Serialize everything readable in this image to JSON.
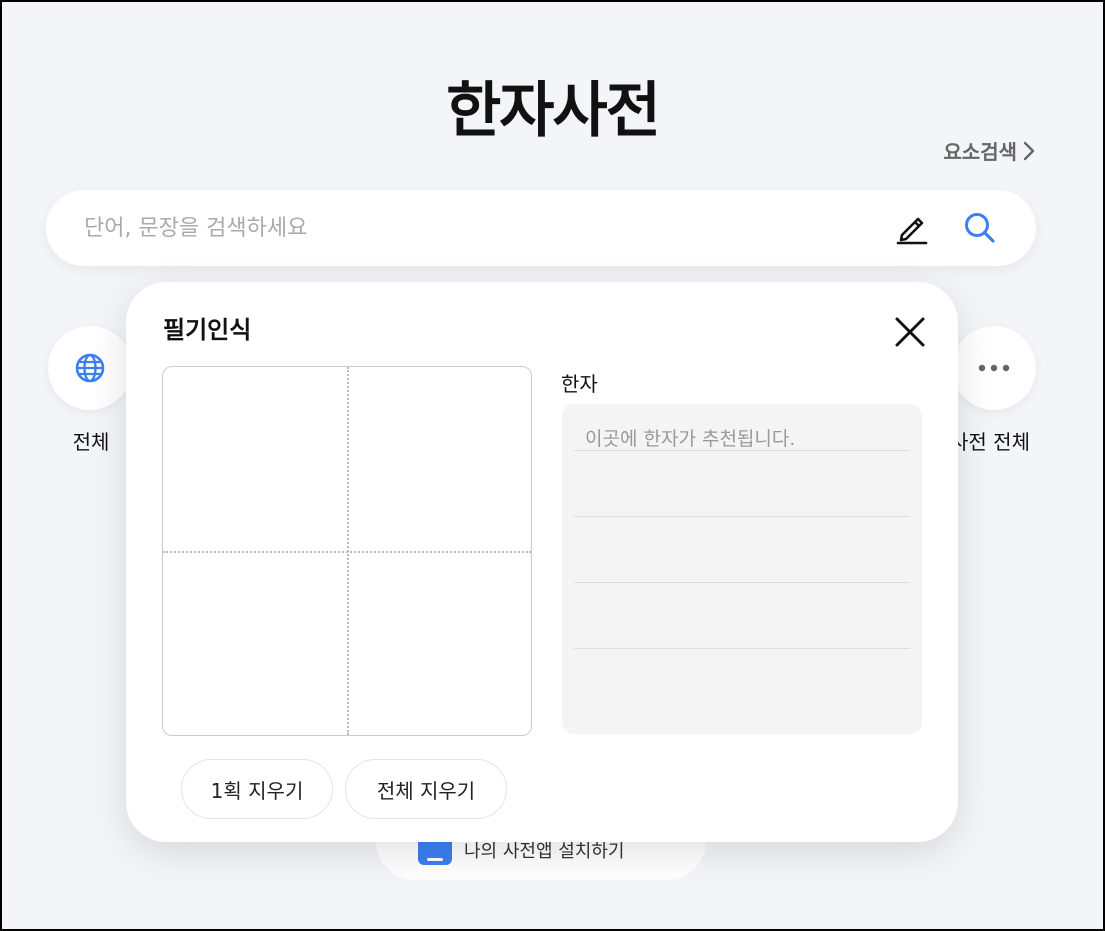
{
  "page": {
    "title": "한자사전",
    "element_search_label": "요소검색"
  },
  "search": {
    "placeholder": "단어, 문장을 검색하세요"
  },
  "categories": [
    {
      "label": "전체",
      "icon": "globe-icon"
    },
    {
      "label": "사전 전체",
      "icon": "more-dots-icon"
    }
  ],
  "bottom_button": {
    "label": "나의 사전앱 설치하기",
    "icon": "book-icon"
  },
  "handwriting": {
    "title": "필기인식",
    "result_label": "한자",
    "result_hint": "이곳에 한자가 추천됩니다.",
    "undo_label": "1획 지우기",
    "clear_label": "전체 지우기"
  },
  "colors": {
    "accent": "#3c7ff1",
    "background": "#f4f5f8"
  }
}
